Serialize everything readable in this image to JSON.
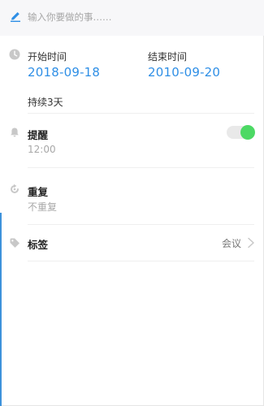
{
  "title_input": {
    "placeholder": "输入你要做的事……"
  },
  "time": {
    "start_label": "开始时间",
    "start_value": "2018-09-18",
    "end_label": "结束时间",
    "end_value": "2010-09-20",
    "duration": "持续3天"
  },
  "reminder": {
    "label": "提醒",
    "time": "12:00",
    "enabled": true
  },
  "repeat": {
    "label": "重复",
    "value": "不重复"
  },
  "tags": {
    "label": "标签",
    "value": "会议"
  },
  "colors": {
    "accent_blue": "#2f8fe6",
    "toggle_on": "#4cd964"
  }
}
